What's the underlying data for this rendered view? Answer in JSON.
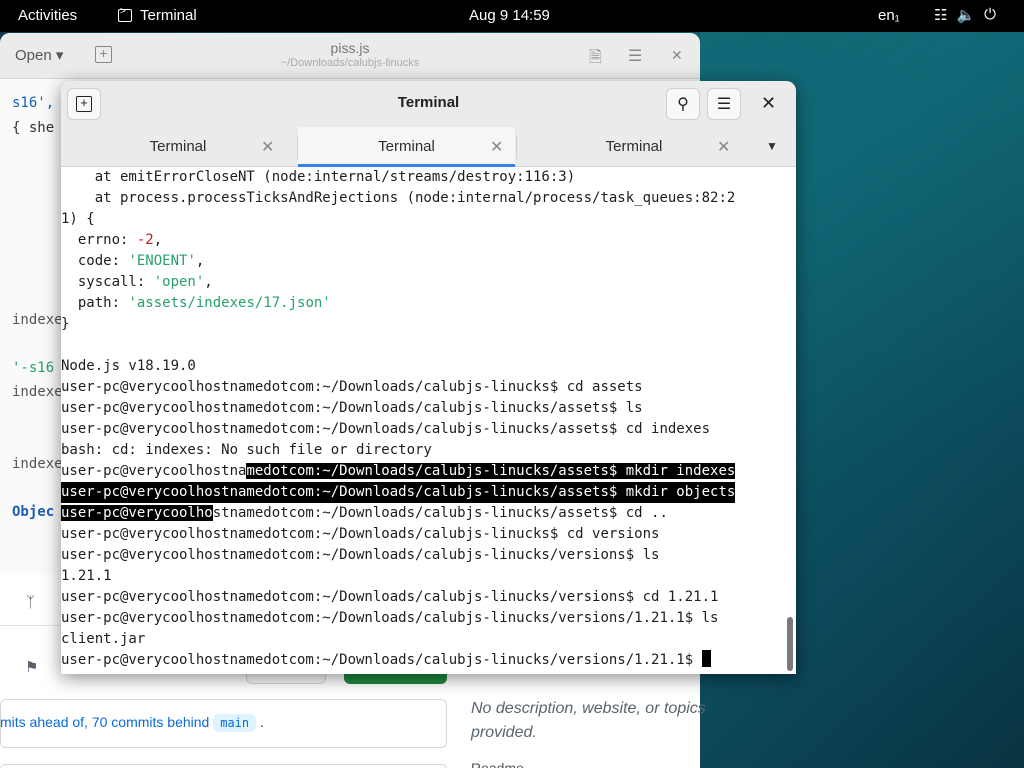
{
  "topbar": {
    "activities": "Activities",
    "app_name": "Terminal",
    "clock": "Aug 9  14:59",
    "lang": "en₁",
    "network_icon": "network-icon",
    "volume_icon": "volume-icon",
    "power_icon": "power-icon"
  },
  "editor": {
    "open_label": "Open",
    "filename": "piss.js",
    "path": "~/Downloads/calubjs-linucks",
    "code_fragments": [
      "s16',",
      "{ she",
      "indexe",
      "'-s16",
      "indexe",
      "indexe",
      "Objec"
    ]
  },
  "github": {
    "ahead_text": "mits ahead of, ",
    "behind_text": "70 commits behind",
    "branch": "main",
    "period": ".",
    "description": "No description, website, or topics provided.",
    "readme": "Readme"
  },
  "terminal": {
    "title": "Terminal",
    "tabs": [
      {
        "label": "Terminal",
        "active": false
      },
      {
        "label": "Terminal",
        "active": true
      },
      {
        "label": "Terminal",
        "active": false
      }
    ],
    "lines": {
      "l1": "    at emitErrorCloseNT (node:internal/streams/destroy:116:3)",
      "l2": "    at process.processTicksAndRejections (node:internal/process/task_queues:82:2",
      "l3": "1) {",
      "l4_key": "  errno: ",
      "l4_val": "-2",
      "l4_end": ",",
      "l5_key": "  code: ",
      "l5_val": "'ENOENT'",
      "l5_end": ",",
      "l6_key": "  syscall: ",
      "l6_val": "'open'",
      "l6_end": ",",
      "l7_key": "  path: ",
      "l7_val": "'assets/indexes/17.json'",
      "l8": "}",
      "l9": "Node.js v18.19.0",
      "l10": "user-pc@verycoolhostnamedotcom:~/Downloads/calubjs-linucks$ cd assets",
      "l11": "user-pc@verycoolhostnamedotcom:~/Downloads/calubjs-linucks/assets$ ls",
      "l12": "user-pc@verycoolhostnamedotcom:~/Downloads/calubjs-linucks/assets$ cd indexes",
      "l13": "bash: cd: indexes: No such file or directory",
      "l14_a": "user-pc@verycoolhostna",
      "l14_b": "medotcom:~/Downloads/calubjs-linucks/assets$ mkdir indexes",
      "l15": "user-pc@verycoolhostnamedotcom:~/Downloads/calubjs-linucks/assets$ mkdir objects",
      "l16_a": "user-pc@verycoolho",
      "l16_b": "stnamedotcom:~/Downloads/calubjs-linucks/assets$ cd ..",
      "l17": "user-pc@verycoolhostnamedotcom:~/Downloads/calubjs-linucks$ cd versions",
      "l18": "user-pc@verycoolhostnamedotcom:~/Downloads/calubjs-linucks/versions$ ls",
      "l19": "1.21.1",
      "l20": "user-pc@verycoolhostnamedotcom:~/Downloads/calubjs-linucks/versions$ cd 1.21.1",
      "l21": "user-pc@verycoolhostnamedotcom:~/Downloads/calubjs-linucks/versions/1.21.1$ ls",
      "l22": "client.jar",
      "l23": "user-pc@verycoolhostnamedotcom:~/Downloads/calubjs-linucks/versions/1.21.1$ "
    }
  }
}
